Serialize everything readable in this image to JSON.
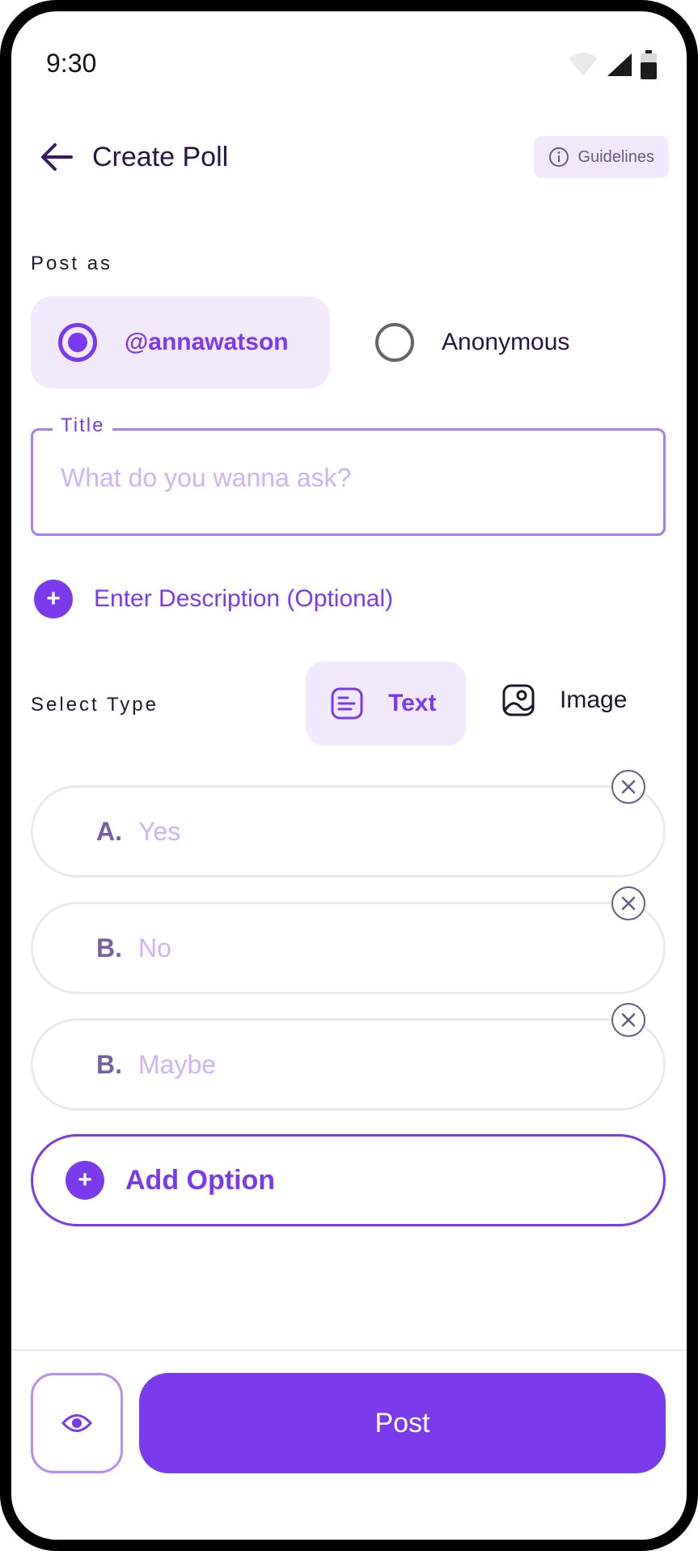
{
  "status_bar": {
    "time": "9:30"
  },
  "header": {
    "title": "Create Poll",
    "guidelines_label": "Guidelines"
  },
  "post_as": {
    "label": "Post as",
    "options": [
      {
        "label": "@annawatson",
        "selected": true
      },
      {
        "label": "Anonymous",
        "selected": false
      }
    ]
  },
  "title_field": {
    "label": "Title",
    "placeholder": "What do you wanna ask?",
    "value": ""
  },
  "description": {
    "label": "Enter Description (Optional)"
  },
  "select_type": {
    "label": "Select Type",
    "options": [
      {
        "label": "Text",
        "selected": true,
        "icon": "text-lines-icon"
      },
      {
        "label": "Image",
        "selected": false,
        "icon": "image-icon"
      }
    ]
  },
  "poll_options": [
    {
      "letter": "A.",
      "placeholder": "Yes"
    },
    {
      "letter": "B.",
      "placeholder": "No"
    },
    {
      "letter": "B.",
      "placeholder": "Maybe"
    }
  ],
  "add_option_label": "Add Option",
  "footer": {
    "post_label": "Post"
  },
  "colors": {
    "accent": "#7c3aed",
    "accent_soft": "#f3e9fd",
    "placeholder": "#d0b3f5",
    "text_dark": "#2a1446"
  }
}
